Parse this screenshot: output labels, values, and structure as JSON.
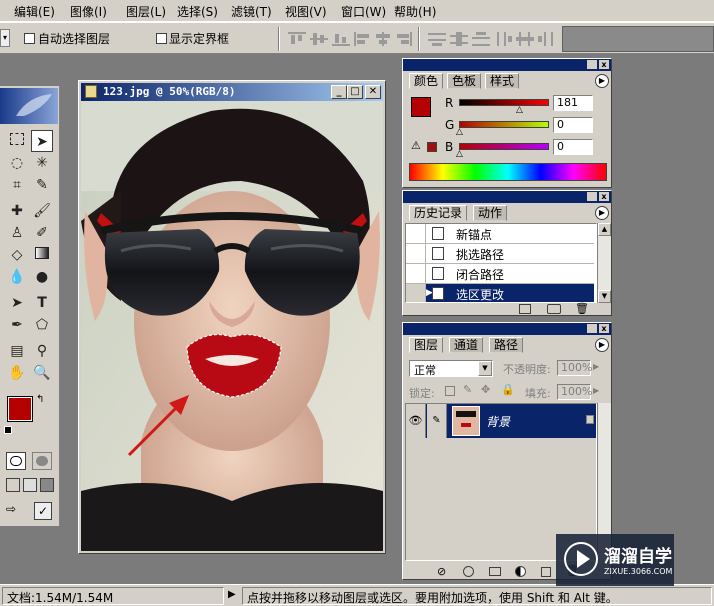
{
  "menu": [
    "编辑(E)",
    "图像(I)",
    "图层(L)",
    "选择(S)",
    "滤镜(T)",
    "视图(V)",
    "窗口(W)",
    "帮助(H)"
  ],
  "options": {
    "auto_select": "自动选择图层",
    "show_bounds": "显示定界框"
  },
  "document": {
    "title": "123.jpg @ 50%(RGB/8)"
  },
  "color_palette": {
    "tabs": [
      "颜色",
      "色板",
      "样式"
    ],
    "channels": [
      {
        "label": "R",
        "value": "181"
      },
      {
        "label": "G",
        "value": "0"
      },
      {
        "label": "B",
        "value": "0"
      }
    ],
    "foreground": "#b50000"
  },
  "history_palette": {
    "tabs": [
      "历史记录",
      "动作"
    ],
    "items": [
      "新锚点",
      "挑选路径",
      "闭合路径",
      "选区更改"
    ],
    "selected_index": 3
  },
  "layers_palette": {
    "tabs": [
      "图层",
      "通道",
      "路径"
    ],
    "blend_mode": "正常",
    "opacity_label": "不透明度:",
    "opacity_value": "100%",
    "lock_label": "锁定:",
    "fill_label": "填充:",
    "fill_value": "100%",
    "layer_name": "背景"
  },
  "status": {
    "doc_size": "文档:1.54M/1.54M",
    "hint": "点按并拖移以移动图层或选区。要用附加选项，使用 Shift 和 Alt 键。"
  },
  "watermark": {
    "brand": "溜溜自学",
    "url": "ZIXUE.3066.COM"
  },
  "colors": {
    "ui_gray": "#d4d0c8",
    "title_blue": "#0a246a",
    "selection_red": "#b50000",
    "arrow_red": "#d01818"
  }
}
